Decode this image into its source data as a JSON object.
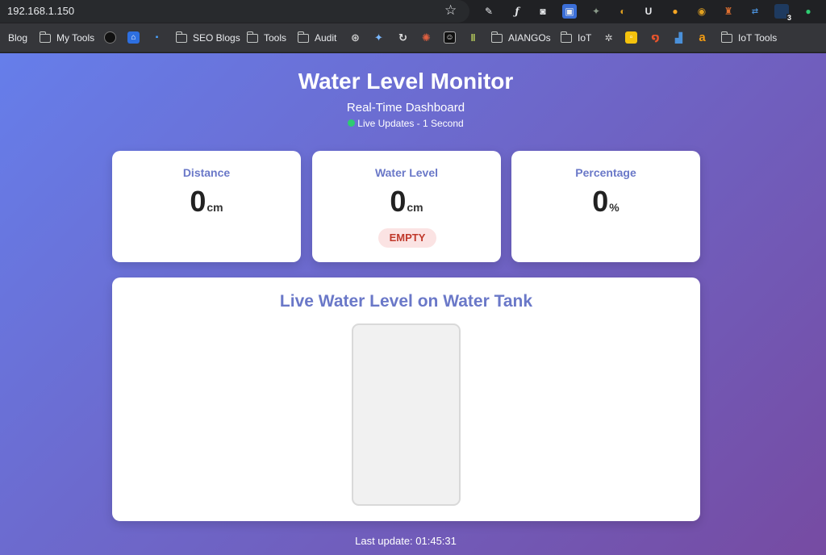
{
  "browser": {
    "url": "192.168.1.150",
    "bookmarks": {
      "blog": "Blog",
      "my_tools": "My Tools",
      "seo_blogs": "SEO Blogs",
      "tools": "Tools",
      "audit": "Audit",
      "aiangos": "AIANGOs",
      "iot": "IoT",
      "iot_tools": "IoT Tools"
    },
    "extension_badge": "3"
  },
  "header": {
    "title": "Water Level Monitor",
    "subtitle": "Real-Time Dashboard",
    "live_text": "Live Updates - 1 Second",
    "live_color": "#2ecc71"
  },
  "cards": {
    "distance": {
      "label": "Distance",
      "value": "0",
      "unit": "cm"
    },
    "water_level": {
      "label": "Water Level",
      "value": "0",
      "unit": "cm",
      "status": "EMPTY"
    },
    "percentage": {
      "label": "Percentage",
      "value": "0",
      "unit": "%"
    }
  },
  "tank": {
    "title": "Live Water Level on Water Tank",
    "fill_percent": 0
  },
  "footer": {
    "last_update": "Last update: 01:45:31"
  },
  "colors": {
    "gradient_start": "#667eea",
    "gradient_end": "#764ba2",
    "accent_text": "#6a78c8",
    "status_empty": "#c0392b"
  }
}
